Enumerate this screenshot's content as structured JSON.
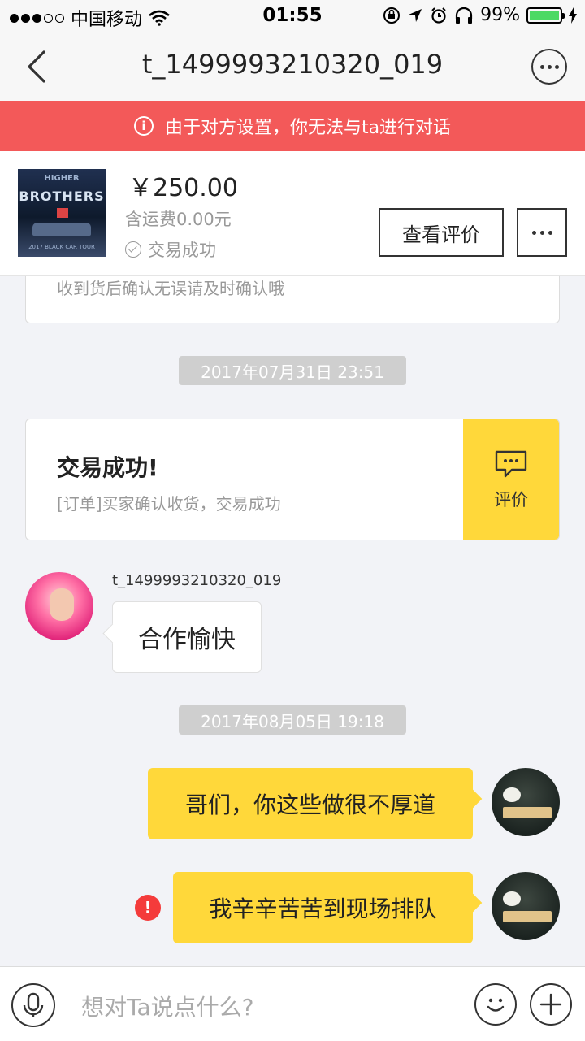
{
  "status_bar": {
    "carrier": "中国移动",
    "time": "01:55",
    "battery": "99%",
    "battery_level": 0.99
  },
  "nav": {
    "title": "t_1499993210320_019"
  },
  "alert": {
    "text": "由于对方设置，你无法与ta进行对话"
  },
  "product": {
    "image_text_top": "BROTHERS",
    "image_text_small": "HIGHER",
    "image_text_bottom": "2017 BLACK CAR TOUR",
    "price": "￥250.00",
    "shipping": "含运费0.00元",
    "status": "交易成功",
    "review_button": "查看评价"
  },
  "messages": {
    "previous_card_text": "收到货后确认无误请及时确认哦",
    "time1": "2017年07月31日  23:51",
    "order_title": "交易成功!",
    "order_subtitle": "[订单]买家确认收货，交易成功",
    "order_action": "评价",
    "other_username": "t_1499993210320_019",
    "other_message": "合作愉快",
    "time2": "2017年08月05日  19:18",
    "my_message_1": "哥们，你这些做很不厚道",
    "my_message_2": "我辛辛苦苦到现场排队",
    "error_mark": "!"
  },
  "input": {
    "placeholder": "想对Ta说点什么?"
  }
}
